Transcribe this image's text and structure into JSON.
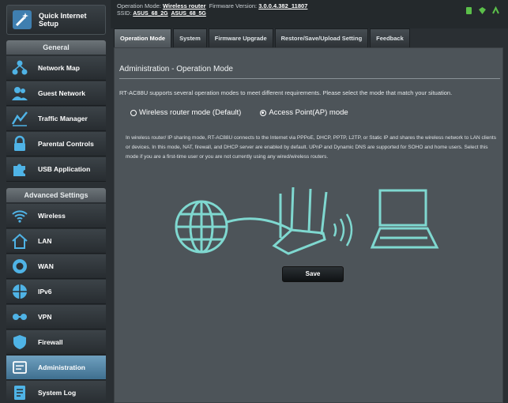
{
  "header": {
    "op_mode_label": "Operation Mode:",
    "op_mode_value": "Wireless router",
    "firmware_label": "Firmware Version:",
    "firmware_value": "3.0.0.4.382_11807",
    "ssid_label": "SSID:",
    "ssid_1": "ASUS_68_2G",
    "ssid_2": "ASUS_68_5G"
  },
  "sidebar": {
    "quick_setup": "Quick Internet Setup",
    "general_header": "General",
    "general_items": [
      {
        "label": "Network Map",
        "icon": "network-map-icon"
      },
      {
        "label": "Guest Network",
        "icon": "guest-network-icon"
      },
      {
        "label": "Traffic Manager",
        "icon": "traffic-manager-icon"
      },
      {
        "label": "Parental Controls",
        "icon": "lock-icon"
      },
      {
        "label": "USB Application",
        "icon": "puzzle-icon"
      }
    ],
    "advanced_header": "Advanced Settings",
    "advanced_items": [
      {
        "label": "Wireless",
        "icon": "wifi-icon"
      },
      {
        "label": "LAN",
        "icon": "home-icon"
      },
      {
        "label": "WAN",
        "icon": "globe-icon"
      },
      {
        "label": "IPv6",
        "icon": "ipv6-icon"
      },
      {
        "label": "VPN",
        "icon": "vpn-icon"
      },
      {
        "label": "Firewall",
        "icon": "shield-icon"
      },
      {
        "label": "Administration",
        "icon": "admin-icon",
        "active": true
      },
      {
        "label": "System Log",
        "icon": "system-log-icon"
      }
    ]
  },
  "tabs": [
    {
      "label": "Operation Mode",
      "active": true
    },
    {
      "label": "System"
    },
    {
      "label": "Firmware Upgrade"
    },
    {
      "label": "Restore/Save/Upload Setting"
    },
    {
      "label": "Feedback"
    }
  ],
  "main": {
    "title": "Administration - Operation Mode",
    "description": "RT-AC88U supports several operation modes to meet different requirements. Please select the mode that match your situation.",
    "modes": [
      {
        "label": "Wireless router mode (Default)",
        "selected": false
      },
      {
        "label": "Access Point(AP) mode",
        "selected": true
      }
    ],
    "explanation": "In wireless router/ IP sharing mode, RT-AC88U connects to the Internet via PPPoE, DHCP, PPTP, L2TP, or Static IP and shares the wireless network to LAN clients or devices. In this mode, NAT, firewall, and DHCP server are enabled by default. UPnP and Dynamic DNS are supported for SOHO and home users. Select this mode if you are a first-time user or you are not currently using any wired/wireless routers.",
    "save_label": "Save"
  },
  "colors": {
    "panel_bg": "#4d5459",
    "sidebar_bg": "#2a2f33",
    "illustration": "#7fd8d0",
    "active_item": "#5a8bab"
  }
}
